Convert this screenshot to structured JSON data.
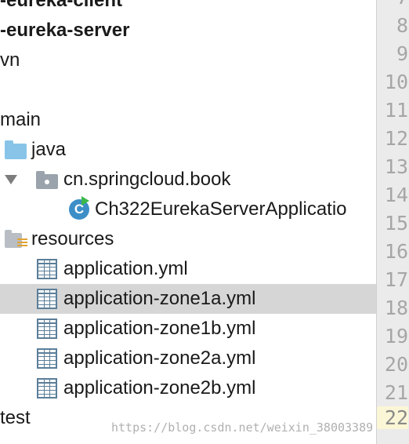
{
  "tree": {
    "items": [
      {
        "label": "-eureka-client"
      },
      {
        "label": "-eureka-server"
      },
      {
        "label": "vn"
      },
      {
        "label": "main"
      },
      {
        "label": "java"
      },
      {
        "label": "cn.springcloud.book"
      },
      {
        "label": "Ch322EurekaServerApplicatio"
      },
      {
        "label": "resources"
      },
      {
        "label": "application.yml"
      },
      {
        "label": "application-zone1a.yml"
      },
      {
        "label": "application-zone1b.yml"
      },
      {
        "label": "application-zone2a.yml"
      },
      {
        "label": "application-zone2b.yml"
      },
      {
        "label": "test"
      }
    ],
    "selected_item": "application-zone1a.yml",
    "expand_arrow_icon": "triangle-down-icon",
    "class_icon_letter": "C"
  },
  "gutter": {
    "line_numbers": [
      "7",
      "8",
      "9",
      "10",
      "11",
      "12",
      "13",
      "14",
      "15",
      "16",
      "17",
      "18",
      "19",
      "20",
      "21",
      "22"
    ],
    "current_line": "22"
  },
  "watermark": "https://blog.csdn.net/weixin_38003389",
  "colors": {
    "selection": "#d6d6d6",
    "folder": "#88c4e8",
    "class_icon": "#3d8ec7",
    "run_badge": "#3db84a",
    "gutter_bg": "#ebebeb",
    "current_line_bg": "#fbf6d6"
  }
}
